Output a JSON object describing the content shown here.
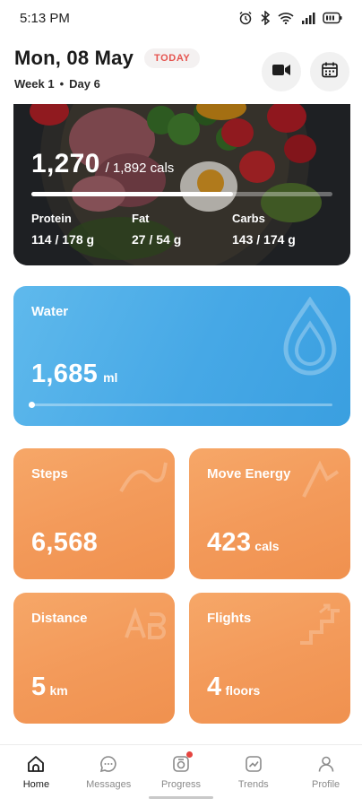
{
  "status_bar": {
    "time": "5:13 PM",
    "icons": [
      "alarm-icon",
      "bluetooth-icon",
      "wifi-icon",
      "signal-icon",
      "battery-icon"
    ]
  },
  "header": {
    "date": "Mon, 08 May",
    "today_badge": "TODAY",
    "week": "Week 1",
    "separator": "•",
    "day": "Day 6",
    "actions": [
      "video-icon",
      "calendar-icon"
    ]
  },
  "nutrition": {
    "calories": "1,270",
    "calories_goal": "/ 1,892 cals",
    "progress_fraction": 0.671,
    "macros": [
      {
        "label": "Protein",
        "value": "114 / 178 g"
      },
      {
        "label": "Fat",
        "value": "27 / 54 g"
      },
      {
        "label": "Carbs",
        "value": "143 / 174 g"
      }
    ]
  },
  "water": {
    "title": "Water",
    "value": "1,685",
    "unit": "ml",
    "progress_fraction": 0.0,
    "icon": "water-drop-icon"
  },
  "tiles": {
    "steps": {
      "title": "Steps",
      "value": "6,568",
      "unit": ""
    },
    "move_energy": {
      "title": "Move Energy",
      "value": "423",
      "unit": "cals"
    },
    "distance": {
      "title": "Distance",
      "value": "5",
      "unit": "km"
    },
    "flights": {
      "title": "Flights",
      "value": "4",
      "unit": "floors"
    }
  },
  "bottom_nav": [
    {
      "label": "Home",
      "icon": "home-icon",
      "active": true
    },
    {
      "label": "Messages",
      "icon": "messages-icon",
      "active": false
    },
    {
      "label": "Progress",
      "icon": "progress-icon",
      "active": false,
      "badge": true
    },
    {
      "label": "Trends",
      "icon": "trends-icon",
      "active": false
    },
    {
      "label": "Profile",
      "icon": "profile-icon",
      "active": false
    }
  ],
  "colors": {
    "accent_red": "#e5544f",
    "water_blue": "#46a8e6",
    "tile_orange": "#f39a5a"
  }
}
